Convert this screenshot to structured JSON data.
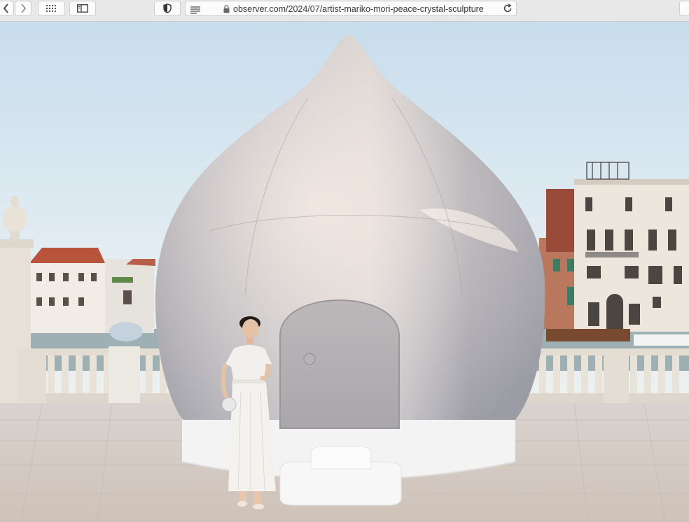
{
  "browser": {
    "url": "observer.com/2024/07/artist-mariko-mori-peace-crystal-sculpture",
    "icons": {
      "back": "chevron-left-icon",
      "forward": "chevron-right-icon",
      "tabs": "grid-icon",
      "sidebar": "sidebar-icon",
      "privacy": "shield-icon",
      "reader": "reader-lines-icon",
      "lock": "lock-icon",
      "reload": "reload-icon"
    }
  },
  "photo": {
    "subject": "Mariko Mori Peace Crystal sculpture",
    "colors": {
      "sky": "#dbe9f2",
      "pavement": "#d8cdc4",
      "sculpture": "#c8c4c4",
      "base": "#f3f3f3"
    }
  }
}
